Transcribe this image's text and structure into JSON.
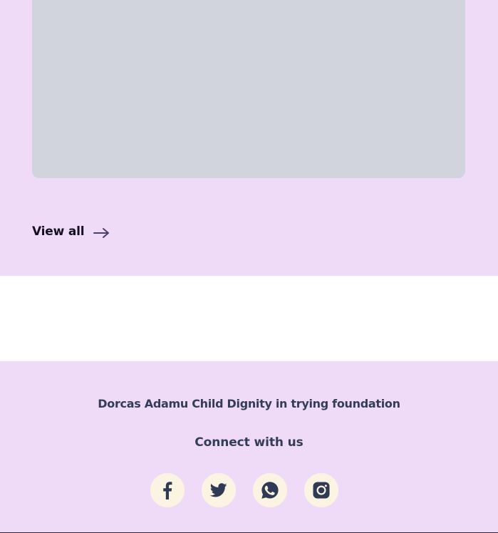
{
  "top_section": {
    "view_all_label": "View all",
    "view_all_icon": "arrow-right-icon"
  },
  "footer": {
    "org_name": "Dorcas Adamu Child Dignity in trying foundation",
    "connect_heading": "Connect with us",
    "social_links": [
      {
        "name": "facebook",
        "icon": "facebook-icon"
      },
      {
        "name": "twitter",
        "icon": "twitter-icon"
      },
      {
        "name": "whatsapp",
        "icon": "whatsapp-icon"
      },
      {
        "name": "instagram",
        "icon": "instagram-icon"
      }
    ]
  },
  "colors": {
    "section_bg": "#efdaf7",
    "placeholder_card": "#d2d4dd",
    "text_dark": "#14101f",
    "footer_text": "#333d57",
    "social_bg": "#fcf4e2",
    "arrow": "#4a3f6b"
  }
}
